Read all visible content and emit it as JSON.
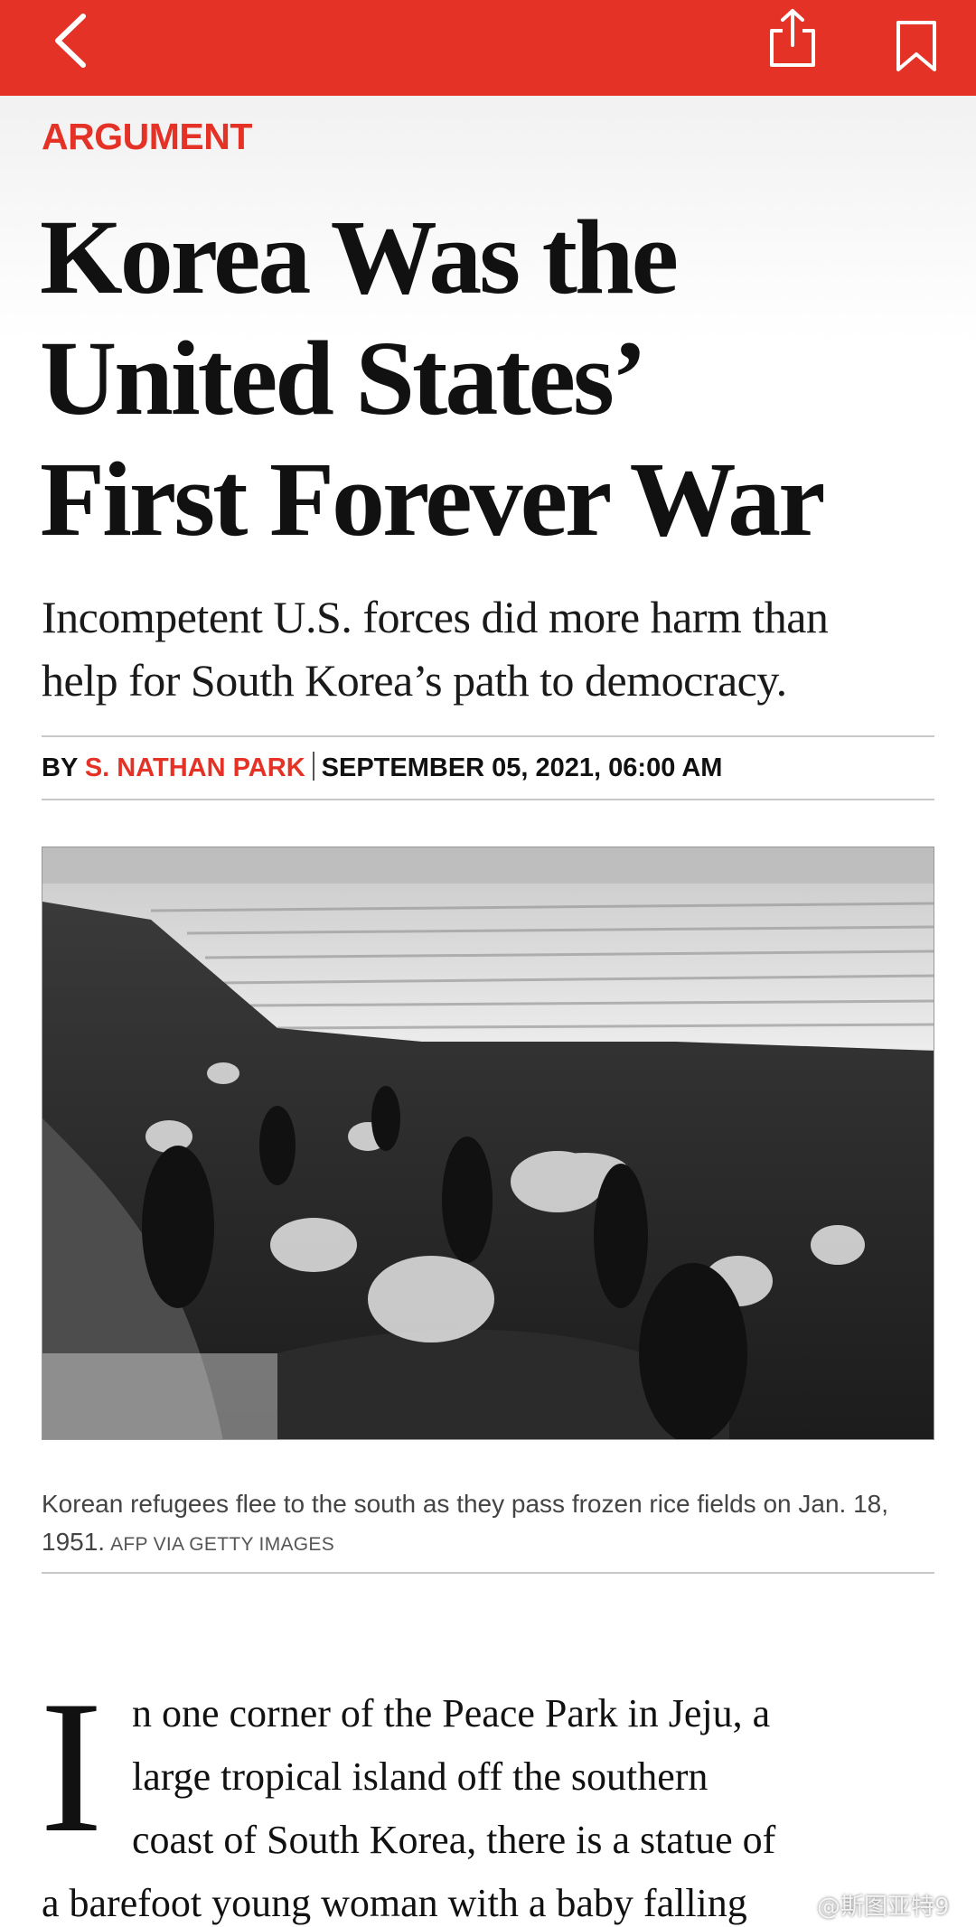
{
  "toolbar": {
    "back_icon": "chevron-left-icon",
    "share_icon": "share-icon",
    "bookmark_icon": "bookmark-icon",
    "accent_color": "#e53227"
  },
  "article": {
    "section": "ARGUMENT",
    "headline": [
      "Korea Was the",
      "United States’",
      "First Forever War"
    ],
    "dek": [
      "Incompetent U.S. forces did more harm than",
      "help for South Korea’s path to democracy."
    ],
    "byline": {
      "prefix": "BY",
      "author": "S. NATHAN PARK",
      "date": "SEPTEMBER 05, 2021, 06:00 AM"
    },
    "image": {
      "caption": "Korean refugees flee to the south as they pass frozen rice fields on Jan. 18, 1951.",
      "credit": "AFP VIA GETTY IMAGES"
    },
    "body": {
      "drop_cap": "I",
      "lines": [
        "n one corner of the Peace Park in Jeju, a",
        "large tropical island off the southern",
        "coast of South Korea, there is a statue of",
        "a barefoot young woman with a baby falling"
      ]
    }
  },
  "watermark": "@斯图亚特9"
}
